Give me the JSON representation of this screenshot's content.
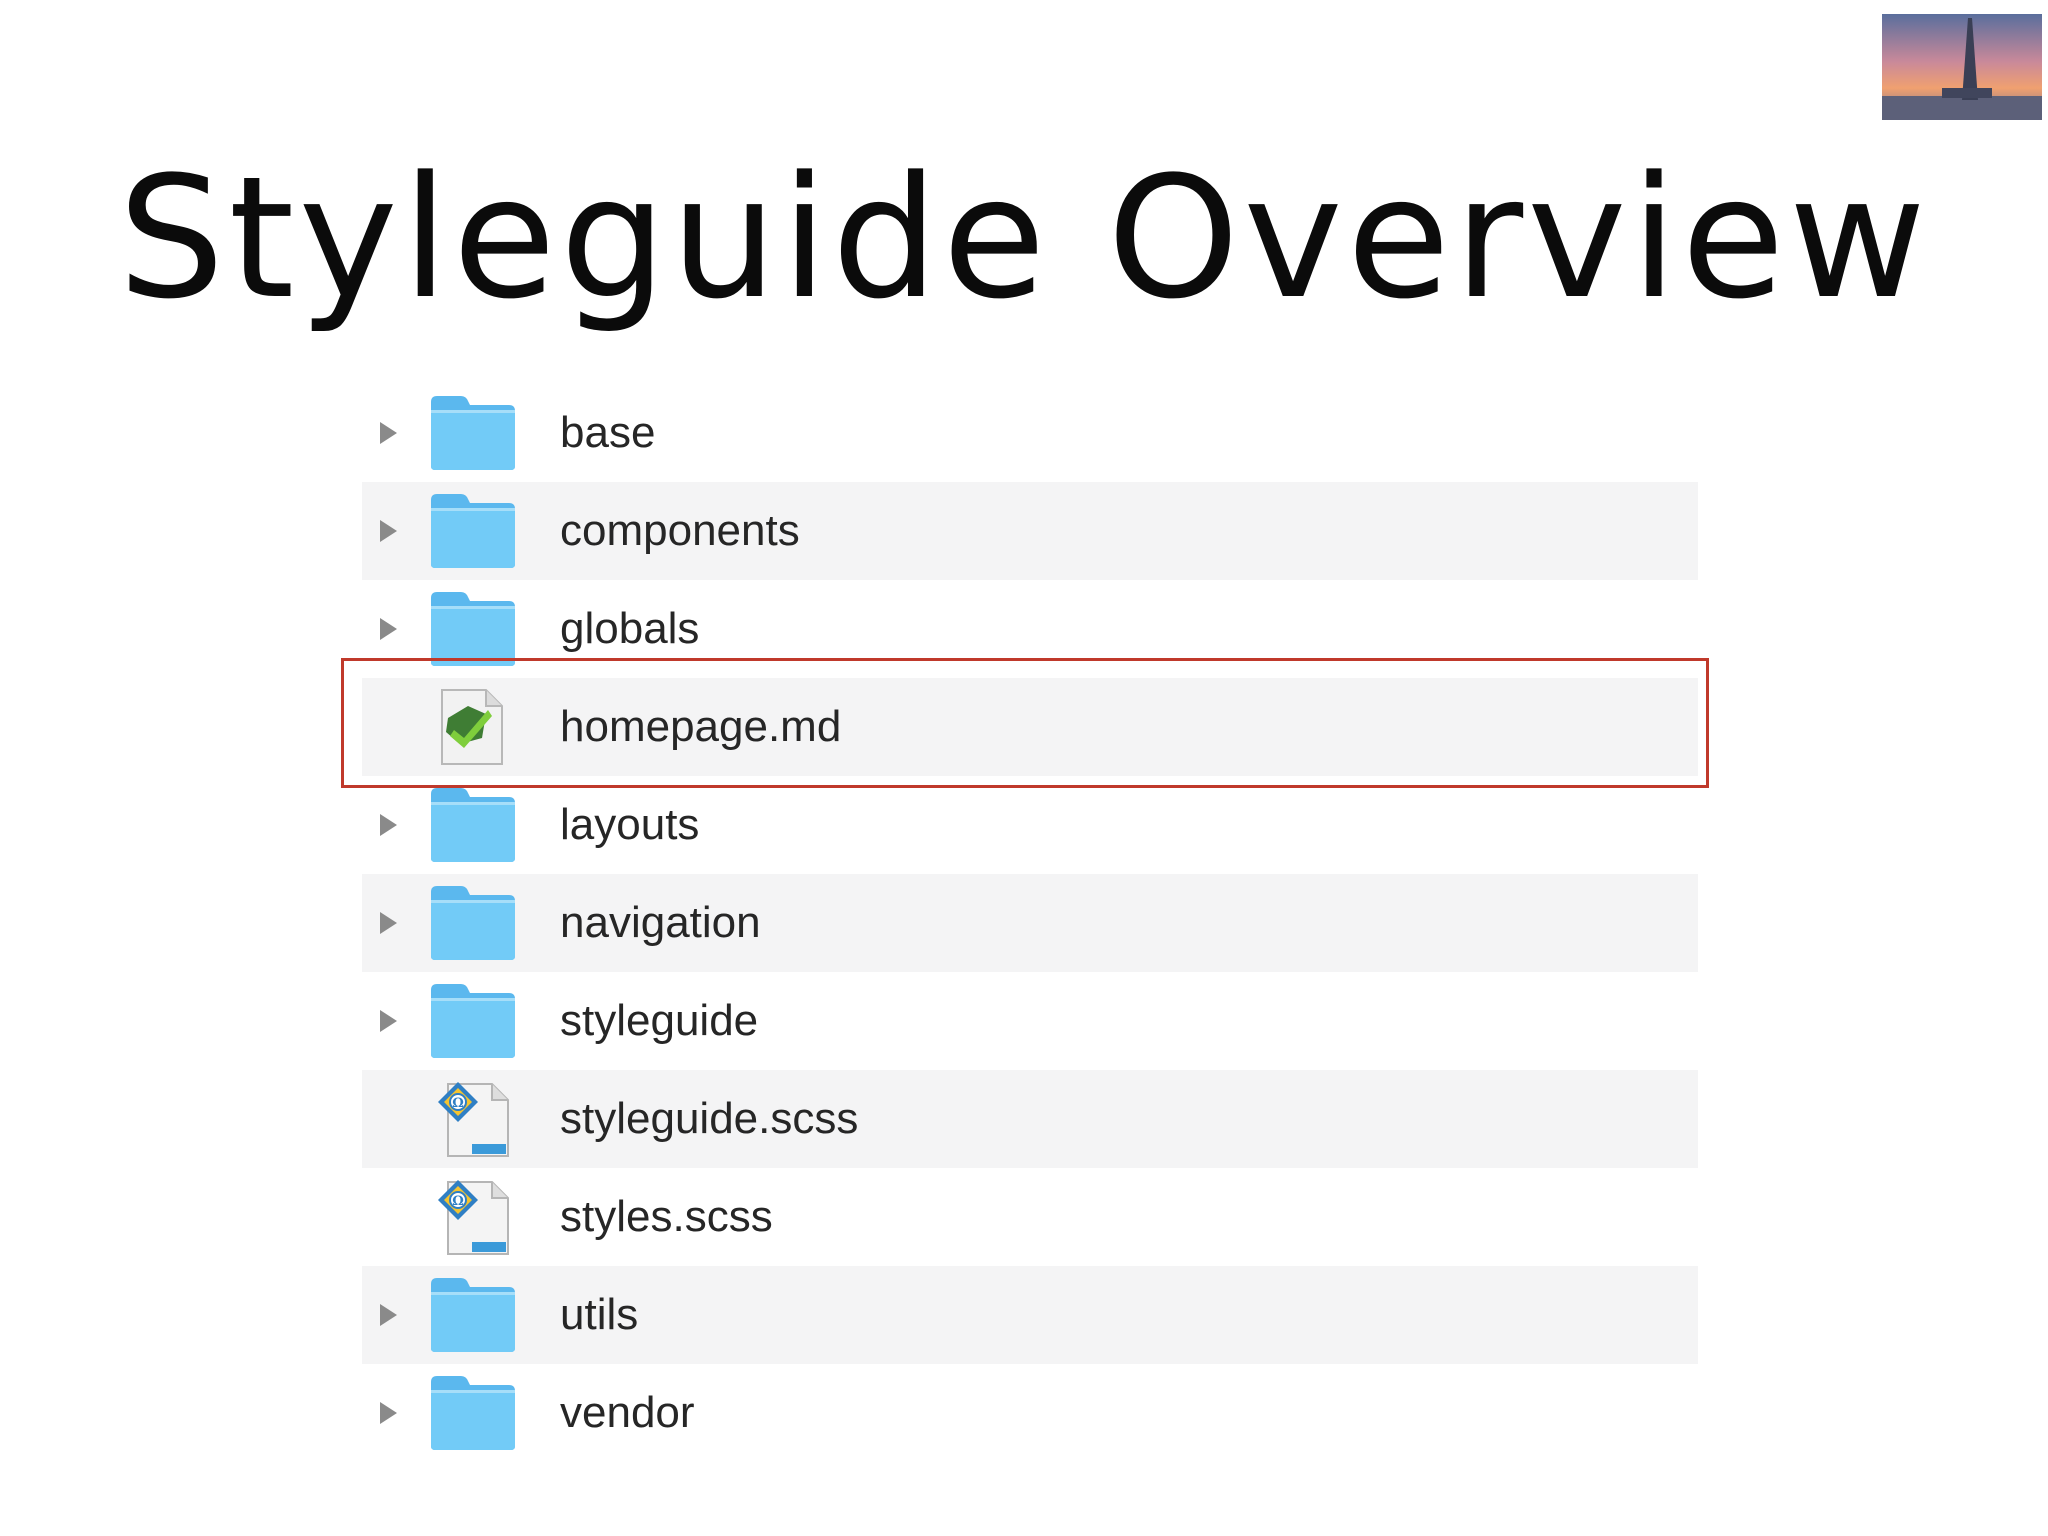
{
  "slide": {
    "title": "Styleguide Overview"
  },
  "file_list": {
    "items": [
      {
        "name": "base",
        "type": "folder",
        "icon": "folder-icon"
      },
      {
        "name": "components",
        "type": "folder",
        "icon": "folder-icon"
      },
      {
        "name": "globals",
        "type": "folder",
        "icon": "folder-icon"
      },
      {
        "name": "homepage.md",
        "type": "file",
        "icon": "markdown-file-icon",
        "highlighted": true
      },
      {
        "name": "layouts",
        "type": "folder",
        "icon": "folder-icon"
      },
      {
        "name": "navigation",
        "type": "folder",
        "icon": "folder-icon"
      },
      {
        "name": "styleguide",
        "type": "folder",
        "icon": "folder-icon"
      },
      {
        "name": "styleguide.scss",
        "type": "file",
        "icon": "scss-text-file-icon"
      },
      {
        "name": "styles.scss",
        "type": "file",
        "icon": "scss-text-file-icon"
      },
      {
        "name": "utils",
        "type": "folder",
        "icon": "folder-icon"
      },
      {
        "name": "vendor",
        "type": "folder",
        "icon": "folder-icon"
      }
    ]
  },
  "colors": {
    "folder": "#6cc7f6",
    "row_alt": "#f4f4f5",
    "highlight_border": "#c0392b"
  }
}
